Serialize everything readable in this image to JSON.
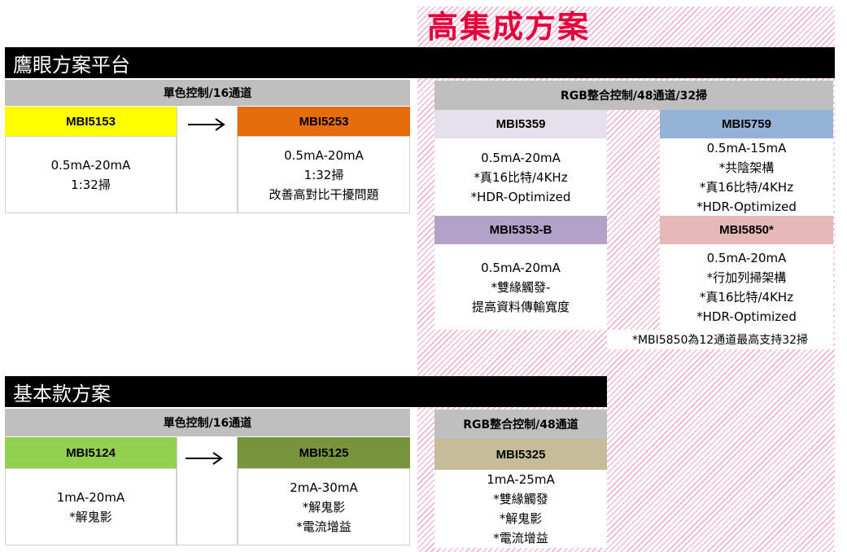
{
  "hi_integration": {
    "title": "高集成方案"
  },
  "eagle": {
    "title": "鷹眼方案平台",
    "mono": {
      "header": "單色控制/16通道",
      "chip_a": {
        "label": "MBI5153",
        "color": "#ffff00",
        "lines": [
          "0.5mA-20mA",
          "1:32掃"
        ]
      },
      "chip_b": {
        "label": "MBI5253",
        "color": "#e46c0a",
        "lines": [
          "0.5mA-20mA",
          "1:32掃",
          "改善高對比干擾問題"
        ]
      }
    },
    "rgb": {
      "header": "RGB整合控制/48通道/32掃",
      "chips": [
        {
          "label": "MBI5359",
          "color": "#e5e0ec",
          "lines": [
            "0.5mA-20mA",
            "*真16比特/4KHz",
            "*HDR-Optimized"
          ]
        },
        {
          "label": "MBI5759",
          "color": "#95b3d7",
          "lines": [
            "0.5mA-15mA",
            "*共陰架構",
            "*真16比特/4KHz",
            "*HDR-Optimized"
          ]
        },
        {
          "label": "MBI5353-B",
          "color": "#b3a2c7",
          "lines": [
            "0.5mA-20mA",
            "*雙緣觸發-",
            "提高資料傳輸寬度"
          ]
        },
        {
          "label": "MBI5850*",
          "color": "#e6b9b8",
          "lines": [
            "0.5mA-20mA",
            "*行加列掃架構",
            "*真16比特/4KHz",
            "*HDR-Optimized"
          ]
        }
      ],
      "footnote": "*MBI5850為12通道最高支持32掃"
    }
  },
  "basic": {
    "title": "基本款方案",
    "mono": {
      "header": "單色控制/16通道",
      "chip_a": {
        "label": "MBI5124",
        "color": "#92d050",
        "lines": [
          "1mA-20mA",
          "*解鬼影"
        ]
      },
      "chip_b": {
        "label": "MBI5125",
        "color": "#77933c",
        "lines": [
          "2mA-30mA",
          "*解鬼影",
          "*電流增益"
        ]
      }
    },
    "rgb": {
      "header": "RGB整合控制/48通道",
      "chip": {
        "label": "MBI5325",
        "color": "#c4bd97",
        "lines": [
          "1mA-25mA",
          "*雙緣觸發",
          "*解鬼影",
          "*電流增益"
        ]
      }
    }
  }
}
